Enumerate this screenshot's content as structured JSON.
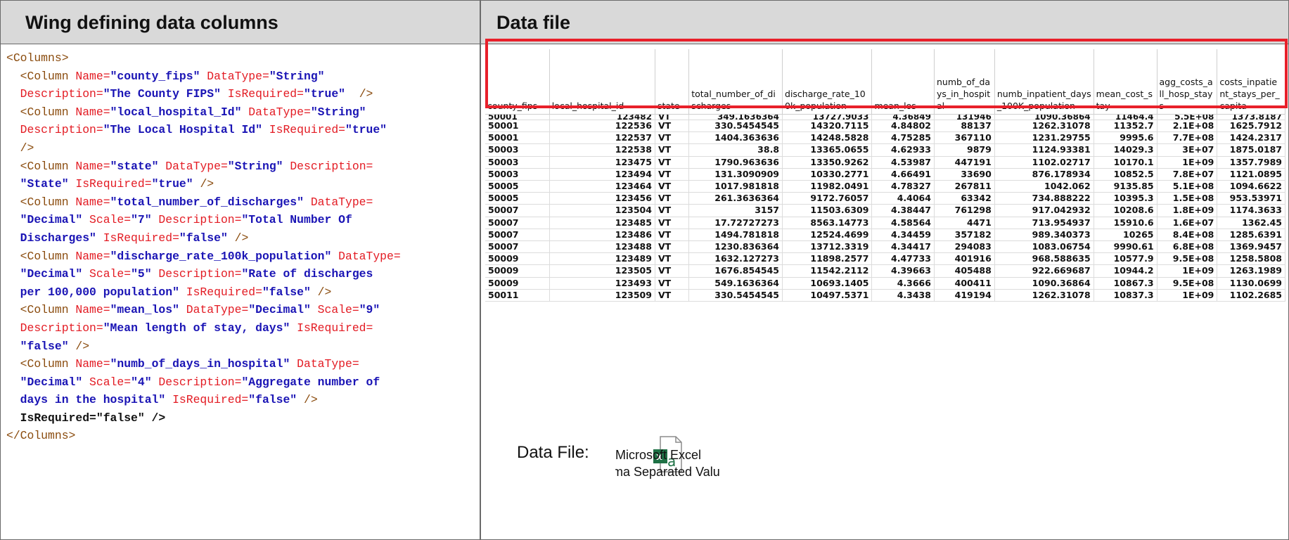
{
  "left_panel": {
    "title": "Wing defining data columns"
  },
  "right_panel": {
    "title": "Data file"
  },
  "xml_lines": [
    [
      {
        "c": "tag",
        "t": "<Columns>"
      }
    ],
    [
      {
        "c": "tag",
        "t": "  <Column "
      },
      {
        "c": "attr",
        "t": "Name="
      },
      {
        "c": "val",
        "t": "\"county_fips\""
      },
      {
        "c": "attr",
        "t": " DataType="
      },
      {
        "c": "val",
        "t": "\"String\""
      }
    ],
    [
      {
        "c": "attr",
        "t": "  Description="
      },
      {
        "c": "val",
        "t": "\"The County FIPS\""
      },
      {
        "c": "attr",
        "t": " IsRequired="
      },
      {
        "c": "val",
        "t": "\"true\""
      },
      {
        "c": "tag",
        "t": "  />"
      }
    ],
    [
      {
        "c": "tag",
        "t": "  <Column "
      },
      {
        "c": "attr",
        "t": "Name="
      },
      {
        "c": "val",
        "t": "\"local_hospital_Id\""
      },
      {
        "c": "attr",
        "t": " DataType="
      },
      {
        "c": "val",
        "t": "\"String\""
      }
    ],
    [
      {
        "c": "attr",
        "t": "  Description="
      },
      {
        "c": "val",
        "t": "\"The Local Hospital Id\""
      },
      {
        "c": "attr",
        "t": " IsRequired="
      },
      {
        "c": "val",
        "t": "\"true\""
      }
    ],
    [
      {
        "c": "tag",
        "t": "  />"
      }
    ],
    [
      {
        "c": "tag",
        "t": "  <Column "
      },
      {
        "c": "attr",
        "t": "Name="
      },
      {
        "c": "val",
        "t": "\"state\""
      },
      {
        "c": "attr",
        "t": " DataType="
      },
      {
        "c": "val",
        "t": "\"String\""
      },
      {
        "c": "attr",
        "t": " Description="
      }
    ],
    [
      {
        "c": "val",
        "t": "  \"State\""
      },
      {
        "c": "attr",
        "t": " IsRequired="
      },
      {
        "c": "val",
        "t": "\"true\""
      },
      {
        "c": "tag",
        "t": " />"
      }
    ],
    [
      {
        "c": "tag",
        "t": "  <Column "
      },
      {
        "c": "attr",
        "t": "Name="
      },
      {
        "c": "val",
        "t": "\"total_number_of_discharges\""
      },
      {
        "c": "attr",
        "t": " DataType="
      }
    ],
    [
      {
        "c": "val",
        "t": "  \"Decimal\""
      },
      {
        "c": "attr",
        "t": " Scale="
      },
      {
        "c": "val",
        "t": "\"7\""
      },
      {
        "c": "attr",
        "t": " Description="
      },
      {
        "c": "val",
        "t": "\"Total Number Of"
      }
    ],
    [
      {
        "c": "val",
        "t": "  Discharges\""
      },
      {
        "c": "attr",
        "t": " IsRequired="
      },
      {
        "c": "val",
        "t": "\"false\""
      },
      {
        "c": "tag",
        "t": " />"
      }
    ],
    [
      {
        "c": "tag",
        "t": "  <Column "
      },
      {
        "c": "attr",
        "t": "Name="
      },
      {
        "c": "val",
        "t": "\"discharge_rate_100k_population\""
      },
      {
        "c": "attr",
        "t": " DataType="
      }
    ],
    [
      {
        "c": "val",
        "t": "  \"Decimal\""
      },
      {
        "c": "attr",
        "t": " Scale="
      },
      {
        "c": "val",
        "t": "\"5\""
      },
      {
        "c": "attr",
        "t": " Description="
      },
      {
        "c": "val",
        "t": "\"Rate of discharges"
      }
    ],
    [
      {
        "c": "val",
        "t": "  per 100,000 population\""
      },
      {
        "c": "attr",
        "t": " IsRequired="
      },
      {
        "c": "val",
        "t": "\"false\""
      },
      {
        "c": "tag",
        "t": " />"
      }
    ],
    [
      {
        "c": "tag",
        "t": "  <Column "
      },
      {
        "c": "attr",
        "t": "Name="
      },
      {
        "c": "val",
        "t": "\"mean_los\""
      },
      {
        "c": "attr",
        "t": " DataType="
      },
      {
        "c": "val",
        "t": "\"Decimal\""
      },
      {
        "c": "attr",
        "t": " Scale="
      },
      {
        "c": "val",
        "t": "\"9\""
      }
    ],
    [
      {
        "c": "attr",
        "t": "  Description="
      },
      {
        "c": "val",
        "t": "\"Mean length of stay, days\""
      },
      {
        "c": "attr",
        "t": " IsRequired="
      }
    ],
    [
      {
        "c": "val",
        "t": "  \"false\""
      },
      {
        "c": "tag",
        "t": " />"
      }
    ],
    [
      {
        "c": "tag",
        "t": "  <Column "
      },
      {
        "c": "attr",
        "t": "Name="
      },
      {
        "c": "val",
        "t": "\"numb_of_days_in_hospital\""
      },
      {
        "c": "attr",
        "t": " DataType="
      }
    ],
    [
      {
        "c": "val",
        "t": "  \"Decimal\""
      },
      {
        "c": "attr",
        "t": " Scale="
      },
      {
        "c": "val",
        "t": "\"4\""
      },
      {
        "c": "attr",
        "t": " Description="
      },
      {
        "c": "val",
        "t": "\"Aggregate number of"
      }
    ],
    [
      {
        "c": "val",
        "t": "  days in the hospital\""
      },
      {
        "c": "attr",
        "t": " IsRequired="
      },
      {
        "c": "val",
        "t": "\"false\""
      },
      {
        "c": "tag",
        "t": " />"
      }
    ],
    [
      {
        "c": "blk",
        "t": "  IsRequired=\"false\" />"
      }
    ],
    [
      {
        "c": "tag",
        "t": "</Columns>"
      }
    ]
  ],
  "sheet": {
    "headers": [
      "county_fips",
      "local_hospital_id",
      "state",
      "total_number_of_discharges",
      "discharge_rate_100k_population",
      "mean_los",
      "numb_of_days_in_hospital",
      "numb_inpatient_days_100K_population",
      "mean_cost_stay",
      "agg_costs_all_hosp_stays",
      "costs_inpatient_stays_per_capita"
    ],
    "partial_row": [
      "50001",
      "123482",
      "VT",
      "349.1636364",
      "13727.9033",
      "4.36849",
      "131946",
      "1090.36864",
      "11464.4",
      "5.5E+08",
      "1373.8187"
    ],
    "rows": [
      [
        "50001",
        "122536",
        "VT",
        "330.5454545",
        "14320.7115",
        "4.84802",
        "88137",
        "1262.31078",
        "11352.7",
        "2.1E+08",
        "1625.7912"
      ],
      [
        "50001",
        "122537",
        "VT",
        "1404.363636",
        "14248.5828",
        "4.75285",
        "367110",
        "1231.29755",
        "9995.6",
        "7.7E+08",
        "1424.2317"
      ],
      [
        "50003",
        "122538",
        "VT",
        "38.8",
        "13365.0655",
        "4.62933",
        "9879",
        "1124.93381",
        "14029.3",
        "3E+07",
        "1875.0187"
      ],
      [
        "50003",
        "123475",
        "VT",
        "1790.963636",
        "13350.9262",
        "4.53987",
        "447191",
        "1102.02717",
        "10170.1",
        "1E+09",
        "1357.7989"
      ],
      [
        "50003",
        "123494",
        "VT",
        "131.3090909",
        "10330.2771",
        "4.66491",
        "33690",
        "876.178934",
        "10852.5",
        "7.8E+07",
        "1121.0895"
      ],
      [
        "50005",
        "123464",
        "VT",
        "1017.981818",
        "11982.0491",
        "4.78327",
        "267811",
        "1042.062",
        "9135.85",
        "5.1E+08",
        "1094.6622"
      ],
      [
        "50005",
        "123456",
        "VT",
        "261.3636364",
        "9172.76057",
        "4.4064",
        "63342",
        "734.888222",
        "10395.3",
        "1.5E+08",
        "953.53971"
      ],
      [
        "50007",
        "123504",
        "VT",
        "3157",
        "11503.6309",
        "4.38447",
        "761298",
        "917.042932",
        "10208.6",
        "1.8E+09",
        "1174.3633"
      ],
      [
        "50007",
        "123485",
        "VT",
        "17.72727273",
        "8563.14773",
        "4.58564",
        "4471",
        "713.954937",
        "15910.6",
        "1.6E+07",
        "1362.45"
      ],
      [
        "50007",
        "123486",
        "VT",
        "1494.781818",
        "12524.4699",
        "4.34459",
        "357182",
        "989.340373",
        "10265",
        "8.4E+08",
        "1285.6391"
      ],
      [
        "50007",
        "123488",
        "VT",
        "1230.836364",
        "13712.3319",
        "4.34417",
        "294083",
        "1083.06754",
        "9990.61",
        "6.8E+08",
        "1369.9457"
      ],
      [
        "50009",
        "123489",
        "VT",
        "1632.127273",
        "11898.2577",
        "4.47733",
        "401916",
        "968.588635",
        "10577.9",
        "9.5E+08",
        "1258.5808"
      ],
      [
        "50009",
        "123505",
        "VT",
        "1676.854545",
        "11542.2112",
        "4.39663",
        "405488",
        "922.669687",
        "10944.2",
        "1E+09",
        "1263.1989"
      ],
      [
        "50009",
        "123493",
        "VT",
        "549.1636364",
        "10693.1405",
        "4.3666",
        "400411",
        "1090.36864",
        "10867.3",
        "9.5E+08",
        "1130.0699"
      ],
      [
        "50011",
        "123509",
        "VT",
        "330.5454545",
        "10497.5371",
        "4.3438",
        "419194",
        "1262.31078",
        "10837.3",
        "1E+09",
        "1102.2685"
      ]
    ]
  },
  "attachment": {
    "label": "Data File:",
    "name_line1": "Microsoft Excel",
    "name_line2": "ma Separated Valu",
    "icon": "excel-csv-file-icon"
  }
}
